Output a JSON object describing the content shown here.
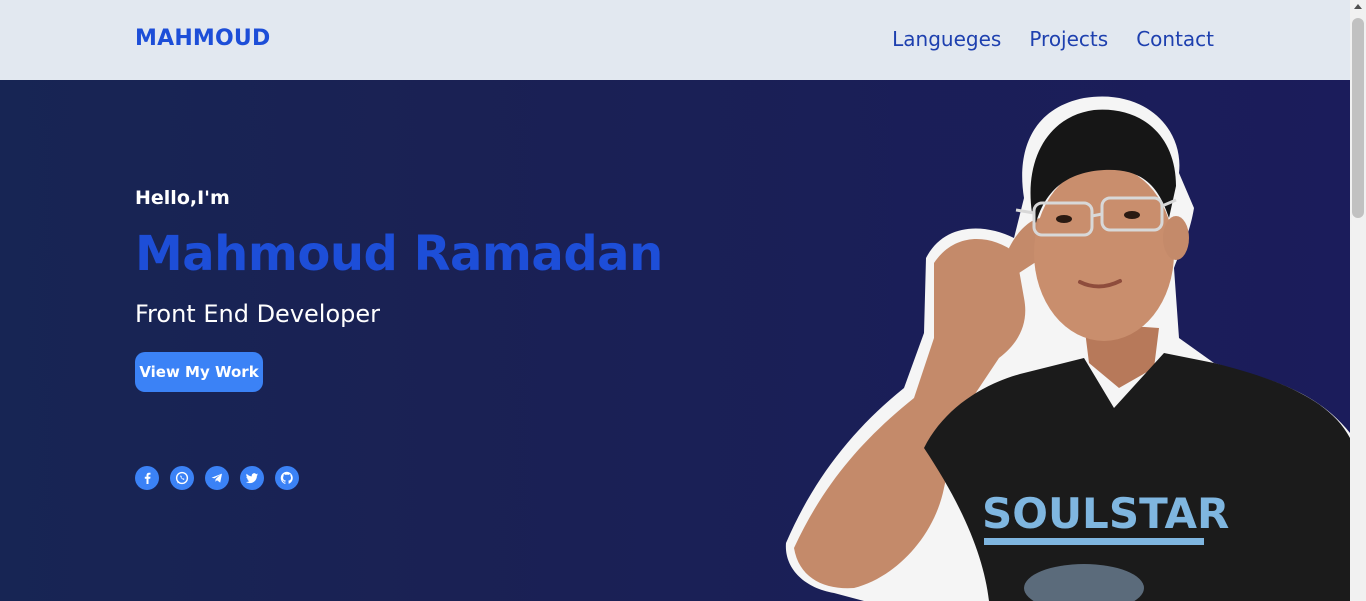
{
  "nav": {
    "logo": "MAHMOUD",
    "links": [
      "Langueges",
      "Projects",
      "Contact"
    ]
  },
  "hero": {
    "greeting": "Hello,I'm",
    "name": "Mahmoud Ramadan",
    "role": "Front End Developer",
    "cta_label": "View My Work"
  },
  "social_icons": [
    "facebook-icon",
    "whatsapp-icon",
    "telegram-icon",
    "twitter-icon",
    "github-icon"
  ],
  "colors": {
    "nav_bg": "#e2e8f0",
    "accent": "#1d4ed8",
    "button": "#3b82f6",
    "hero_bg": "#1b1f5a"
  }
}
